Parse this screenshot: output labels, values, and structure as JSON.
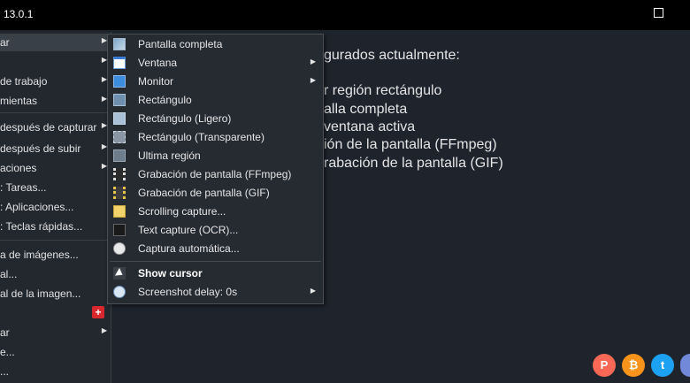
{
  "window": {
    "title": "13.0.1"
  },
  "content": {
    "lines": [
      "gurados actualmente:",
      "r región rectángulo",
      "alla completa",
      "ventana activa",
      "ión de la pantalla (FFmpeg)",
      "rabación de la pantalla (GIF)"
    ]
  },
  "main_menu": {
    "items": [
      {
        "label": "ar",
        "arrow": "▶"
      },
      {
        "label": "",
        "arrow": "▶"
      },
      {
        "label": "de trabajo",
        "arrow": "▶"
      },
      {
        "label": "mientas",
        "arrow": "▶"
      },
      {
        "label": "después de capturar",
        "arrow": "▶"
      },
      {
        "label": "después de subir",
        "arrow": "▶"
      },
      {
        "label": "aciones",
        "arrow": "▶"
      },
      {
        "label": ": Tareas..."
      },
      {
        "label": ": Aplicaciones..."
      },
      {
        "label": ": Teclas rápidas..."
      },
      {
        "label": "a de imágenes..."
      },
      {
        "label": "al..."
      },
      {
        "label": "al de la imagen..."
      },
      {
        "label": "ar",
        "arrow": "▶"
      },
      {
        "label": "e..."
      },
      {
        "label": "..."
      }
    ],
    "update_badge": "+"
  },
  "capture_menu": {
    "items": [
      {
        "label": "Pantalla completa",
        "icon": "fullscreen-icon"
      },
      {
        "label": "Ventana",
        "icon": "window-icon",
        "arrow": "▶"
      },
      {
        "label": "Monitor",
        "icon": "monitor-icon",
        "arrow": "▶"
      },
      {
        "label": "Rectángulo",
        "icon": "rectangle-icon"
      },
      {
        "label": "Rectángulo (Ligero)",
        "icon": "rectangle-light-icon"
      },
      {
        "label": "Rectángulo (Transparente)",
        "icon": "rectangle-transparent-icon"
      },
      {
        "label": "Ultima región",
        "icon": "last-region-icon"
      },
      {
        "label": "Grabación de pantalla (FFmpeg)",
        "icon": "screen-recording-icon"
      },
      {
        "label": "Grabación de pantalla (GIF)",
        "icon": "gif-recording-icon"
      },
      {
        "label": "Scrolling capture...",
        "icon": "scrolling-capture-icon"
      },
      {
        "label": "Text capture (OCR)...",
        "icon": "ocr-icon"
      },
      {
        "label": "Captura automática...",
        "icon": "clock-icon"
      },
      {
        "label": "Show cursor",
        "icon": "cursor-icon",
        "bold": true
      },
      {
        "label": "Screenshot delay: 0s",
        "icon": "delay-icon",
        "arrow": "▶"
      }
    ]
  },
  "social": [
    {
      "name": "patreon",
      "glyph": "P",
      "color": "#f96854"
    },
    {
      "name": "bitcoin",
      "glyph": "₿",
      "color": "#f7931a"
    },
    {
      "name": "twitter",
      "glyph": "t",
      "color": "#1da1f2"
    },
    {
      "name": "discord",
      "glyph": "d",
      "color": "#7289da"
    }
  ]
}
